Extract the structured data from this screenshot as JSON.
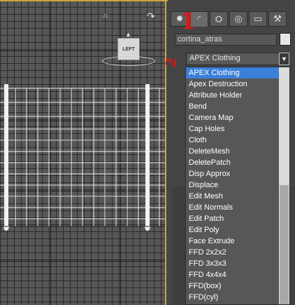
{
  "viewport": {
    "viewcube_label": "LEFT",
    "home_icon": "home-icon",
    "orbit_icon": "orbit-icon"
  },
  "panel": {
    "tabs": [
      {
        "icon": "create-icon",
        "glyph": "✸"
      },
      {
        "icon": "modify-icon",
        "glyph": "◜"
      },
      {
        "icon": "hierarchy-icon",
        "glyph": "⛭"
      },
      {
        "icon": "motion-icon",
        "glyph": "◎"
      },
      {
        "icon": "display-icon",
        "glyph": "▭"
      },
      {
        "icon": "utilities-icon",
        "glyph": "⚒"
      }
    ],
    "object_name": "cortina_atras",
    "modifier_list_value": "APEX Clothing",
    "modifier_list_items": [
      "APEX Clothing",
      "Apex Destruction",
      "Attribute Holder",
      "Bend",
      "Camera Map",
      "Cap Holes",
      "Cloth",
      "DeleteMesh",
      "DeletePatch",
      "Disp Approx",
      "Displace",
      "Edit Mesh",
      "Edit Normals",
      "Edit Patch",
      "Edit Poly",
      "Face Extrude",
      "FFD 2x2x2",
      "FFD 3x3x3",
      "FFD 4x4x4",
      "FFD(box)",
      "FFD(cyl)"
    ],
    "selected_index": 0
  },
  "annotations": {
    "one": "1",
    "two": "2"
  },
  "colors": {
    "viewport_border": "#c7a63b",
    "selection": "#3b80d8",
    "annotation": "#d81818"
  }
}
